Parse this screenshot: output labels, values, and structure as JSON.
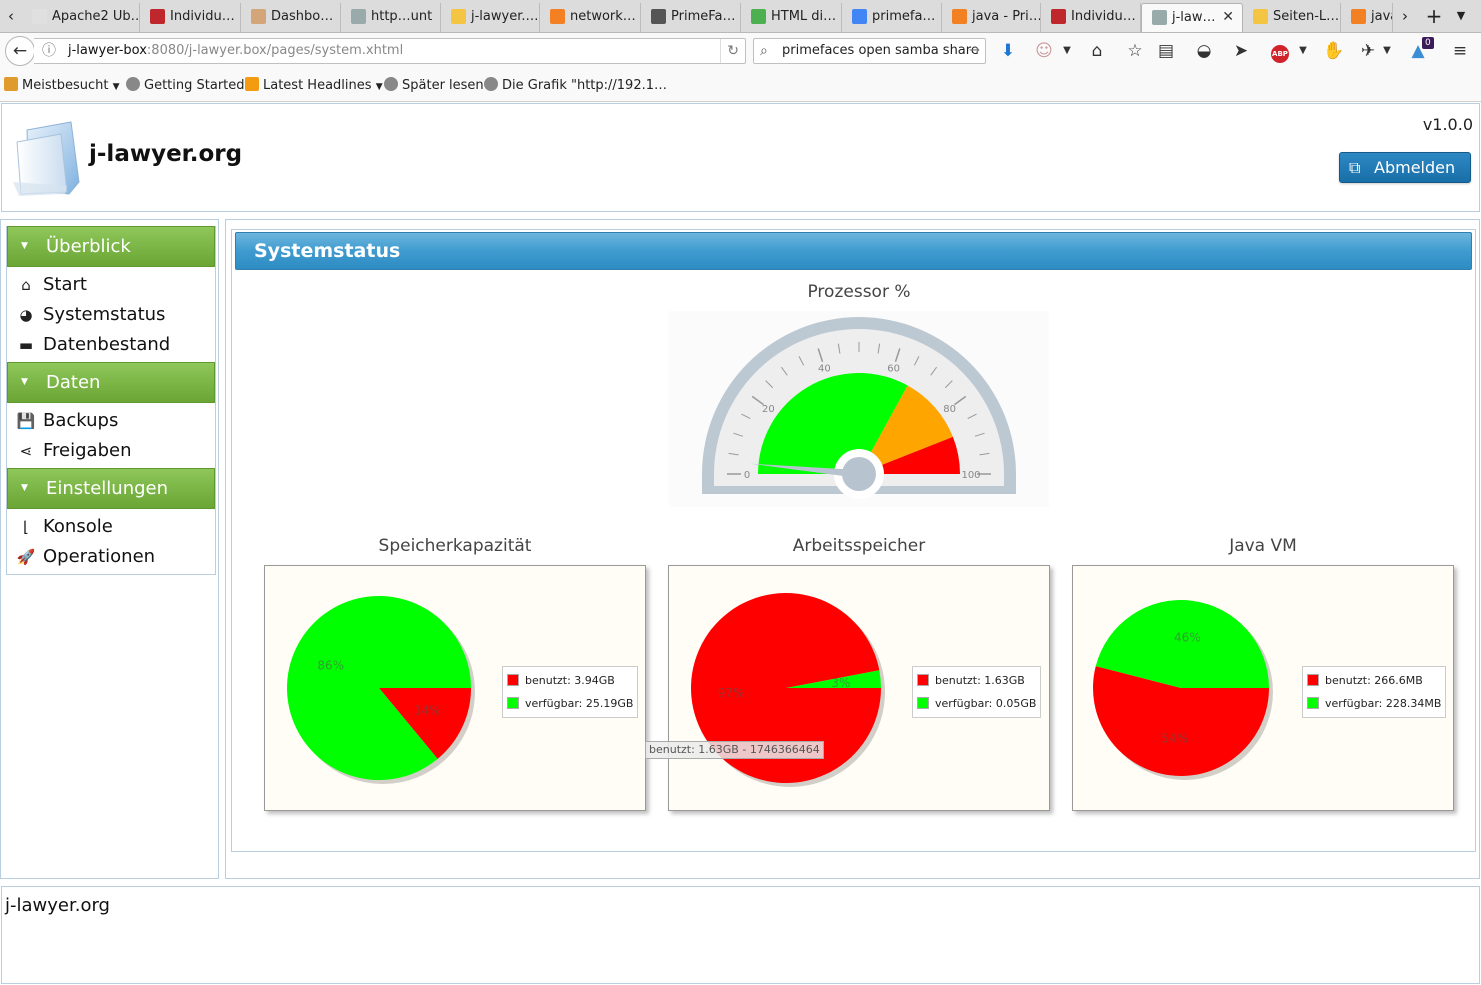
{
  "browser": {
    "tabs": [
      {
        "title": "Apache2 Ub…",
        "icon": "page-icon",
        "color": "#e0e0e0"
      },
      {
        "title": "Individu…",
        "icon": "bug-icon",
        "color": "#c0272d"
      },
      {
        "title": "Dashbo…",
        "icon": "jenkins-icon",
        "color": "#d2a679"
      },
      {
        "title": "http…unt",
        "icon": "page-icon",
        "color": "#9aa"
      },
      {
        "title": "j-lawyer.…",
        "icon": "chat-icon",
        "color": "#f4c542"
      },
      {
        "title": "network…",
        "icon": "stackoverflow-icon",
        "color": "#f48024"
      },
      {
        "title": "PrimeFa…",
        "icon": "shield-icon",
        "color": "#555"
      },
      {
        "title": "HTML di…",
        "icon": "w3-icon",
        "color": "#4caf50"
      },
      {
        "title": "primefa…",
        "icon": "google-icon",
        "color": "#4285f4"
      },
      {
        "title": "java - Pri…",
        "icon": "stackoverflow-icon",
        "color": "#f48024"
      },
      {
        "title": "Individu…",
        "icon": "bug-icon",
        "color": "#c0272d"
      },
      {
        "title": "j-law…",
        "icon": "page-icon",
        "color": "#9aa",
        "active": true
      },
      {
        "title": "Seiten-L…",
        "icon": "chat-icon",
        "color": "#f4c542"
      },
      {
        "title": "java",
        "icon": "stackoverflow-icon",
        "color": "#f48024"
      }
    ],
    "url_host": "j-lawyer-box",
    "url_rest": ":8080/j-lawyer.box/pages/system.xhtml",
    "search_value": "primefaces open samba share",
    "notification_count": "0",
    "bookmarks": [
      "Meistbesucht",
      "Getting Started",
      "Latest Headlines",
      "Später lesen",
      "Die Grafik \"http://192.1…"
    ]
  },
  "header": {
    "title": "j-lawyer.org",
    "version": "v1.0.0",
    "logout_label": "Abmelden"
  },
  "sidebar": {
    "sections": [
      {
        "title": "Überblick",
        "items": [
          {
            "label": "Start",
            "icon": "home-icon"
          },
          {
            "label": "Systemstatus",
            "icon": "pie-chart-icon"
          },
          {
            "label": "Datenbestand",
            "icon": "archive-icon"
          }
        ]
      },
      {
        "title": "Daten",
        "items": [
          {
            "label": "Backups",
            "icon": "save-icon"
          },
          {
            "label": "Freigaben",
            "icon": "share-icon"
          }
        ]
      },
      {
        "title": "Einstellungen",
        "items": [
          {
            "label": "Konsole",
            "icon": "terminal-icon"
          },
          {
            "label": "Operationen",
            "icon": "rocket-icon"
          }
        ]
      }
    ]
  },
  "panel": {
    "title": "Systemstatus"
  },
  "chart_data": [
    {
      "type": "gauge",
      "title": "Prozessor %",
      "min": 0,
      "max": 100,
      "ticks": [
        "0",
        "20",
        "40",
        "60",
        "80",
        "100"
      ],
      "bands": [
        {
          "from": 0,
          "to": 66,
          "color": "#00ff00"
        },
        {
          "from": 66,
          "to": 88,
          "color": "#ffa500"
        },
        {
          "from": 88,
          "to": 100,
          "color": "#ff0000"
        }
      ],
      "value": 3
    },
    {
      "type": "pie",
      "title": "Speicherkapazität",
      "slices": [
        {
          "name": "benutzt: 3.94GB",
          "value": 14,
          "label": "14%",
          "color": "#ff0000"
        },
        {
          "name": "verfügbar: 25.19GB",
          "value": 86,
          "label": "86%",
          "color": "#00ff00"
        }
      ]
    },
    {
      "type": "pie",
      "title": "Arbeitsspeicher",
      "slices": [
        {
          "name": "benutzt: 1.63GB",
          "value": 97,
          "label": "97%",
          "color": "#ff0000"
        },
        {
          "name": "verfügbar: 0.05GB",
          "value": 3,
          "label": "3%",
          "color": "#00ff00"
        }
      ],
      "tooltip": "benutzt: 1.63GB - 1746366464"
    },
    {
      "type": "pie",
      "title": "Java VM",
      "slices": [
        {
          "name": "benutzt: 266.6MB",
          "value": 54,
          "label": "54%",
          "color": "#ff0000"
        },
        {
          "name": "verfügbar: 228.34MB",
          "value": 46,
          "label": "46%",
          "color": "#00ff00"
        }
      ]
    }
  ],
  "footer": {
    "text": "j-lawyer.org"
  }
}
